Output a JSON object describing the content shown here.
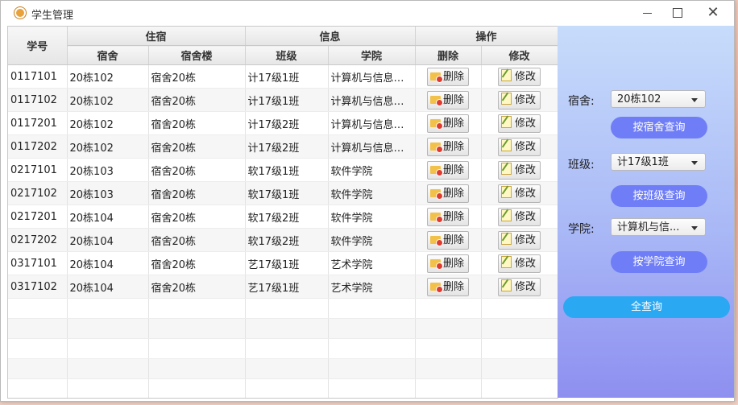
{
  "window": {
    "title": "学生管理",
    "close_glyph": "✕"
  },
  "table": {
    "group_headers": {
      "id": "学号",
      "lodging": "住宿",
      "info": "信息",
      "ops": "操作"
    },
    "sub_headers": {
      "dorm": "宿舍",
      "building": "宿舍楼",
      "class": "班级",
      "college": "学院",
      "delete": "删除",
      "edit": "修改"
    },
    "delete_label": "删除",
    "edit_label": "修改",
    "rows": [
      {
        "id": "0117101",
        "dorm": "20栋102",
        "building": "宿舍20栋",
        "class": "计17级1班",
        "college": "计算机与信息工..."
      },
      {
        "id": "0117102",
        "dorm": "20栋102",
        "building": "宿舍20栋",
        "class": "计17级1班",
        "college": "计算机与信息工..."
      },
      {
        "id": "0117201",
        "dorm": "20栋102",
        "building": "宿舍20栋",
        "class": "计17级2班",
        "college": "计算机与信息工..."
      },
      {
        "id": "0117202",
        "dorm": "20栋102",
        "building": "宿舍20栋",
        "class": "计17级2班",
        "college": "计算机与信息工..."
      },
      {
        "id": "0217101",
        "dorm": "20栋103",
        "building": "宿舍20栋",
        "class": "软17级1班",
        "college": "软件学院"
      },
      {
        "id": "0217102",
        "dorm": "20栋103",
        "building": "宿舍20栋",
        "class": "软17级1班",
        "college": "软件学院"
      },
      {
        "id": "0217201",
        "dorm": "20栋104",
        "building": "宿舍20栋",
        "class": "软17级2班",
        "college": "软件学院"
      },
      {
        "id": "0217202",
        "dorm": "20栋104",
        "building": "宿舍20栋",
        "class": "软17级2班",
        "college": "软件学院"
      },
      {
        "id": "0317101",
        "dorm": "20栋104",
        "building": "宿舍20栋",
        "class": "艺17级1班",
        "college": "艺术学院"
      },
      {
        "id": "0317102",
        "dorm": "20栋104",
        "building": "宿舍20栋",
        "class": "艺17级1班",
        "college": "艺术学院"
      }
    ]
  },
  "side": {
    "dorm_label": "宿舍:",
    "dorm_value": "20栋102",
    "dorm_query": "按宿舍查询",
    "class_label": "班级:",
    "class_value": "计17级1班",
    "class_query": "按班级查询",
    "college_label": "学院:",
    "college_value": "计算机与信...",
    "college_query": "按学院查询",
    "all_query": "全查询"
  },
  "colors": {
    "query_button": "#6f7ef6",
    "all_button": "#2aa8f2",
    "side_top": "#c7dcfb",
    "side_bottom": "#8e8ff0"
  },
  "icons": {
    "delete": "folder-delete-icon",
    "edit": "notepad-edit-icon"
  }
}
